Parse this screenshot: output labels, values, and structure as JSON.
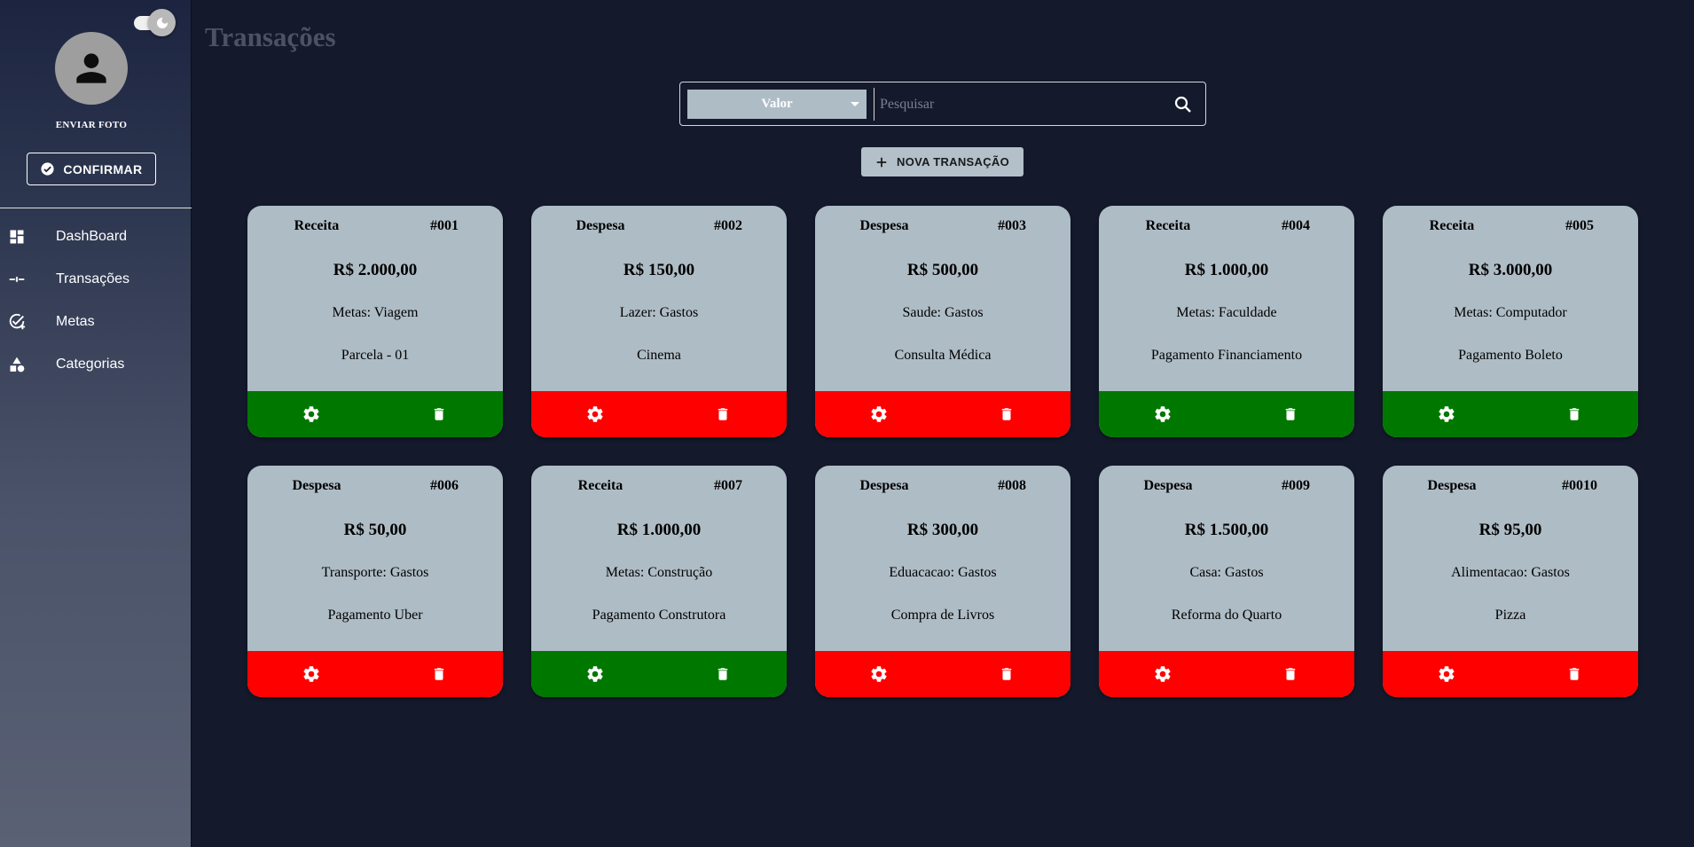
{
  "sidebar": {
    "upload_label": "ENVIAR FOTO",
    "confirm_label": "CONFIRMAR",
    "items": [
      {
        "label": "DashBoard",
        "icon": "dashboard-icon"
      },
      {
        "label": "Transações",
        "icon": "transactions-icon"
      },
      {
        "label": "Metas",
        "icon": "goals-icon"
      },
      {
        "label": "Categorias",
        "icon": "categories-icon"
      }
    ]
  },
  "header": {
    "title": "Transações"
  },
  "search": {
    "filter_selected": "Valor",
    "placeholder": "Pesquisar"
  },
  "new_transaction_label": "NOVA TRANSAÇÃO",
  "colors": {
    "receita": "#007800",
    "despesa": "#ff0000",
    "card_bg": "#aebcc5",
    "page_bg": "#141a2c"
  },
  "transactions": [
    {
      "type": "Receita",
      "id": "#001",
      "value": "R$ 2.000,00",
      "category": "Metas: Viagem",
      "description": "Parcela - 01"
    },
    {
      "type": "Despesa",
      "id": "#002",
      "value": "R$ 150,00",
      "category": "Lazer: Gastos",
      "description": "Cinema"
    },
    {
      "type": "Despesa",
      "id": "#003",
      "value": "R$ 500,00",
      "category": "Saude: Gastos",
      "description": "Consulta Médica"
    },
    {
      "type": "Receita",
      "id": "#004",
      "value": "R$ 1.000,00",
      "category": "Metas: Faculdade",
      "description": "Pagamento Financiamento"
    },
    {
      "type": "Receita",
      "id": "#005",
      "value": "R$ 3.000,00",
      "category": "Metas: Computador",
      "description": "Pagamento Boleto"
    },
    {
      "type": "Despesa",
      "id": "#006",
      "value": "R$ 50,00",
      "category": "Transporte: Gastos",
      "description": "Pagamento Uber"
    },
    {
      "type": "Receita",
      "id": "#007",
      "value": "R$ 1.000,00",
      "category": "Metas: Construção",
      "description": "Pagamento Construtora"
    },
    {
      "type": "Despesa",
      "id": "#008",
      "value": "R$ 300,00",
      "category": "Eduacacao: Gastos",
      "description": "Compra de Livros"
    },
    {
      "type": "Despesa",
      "id": "#009",
      "value": "R$ 1.500,00",
      "category": "Casa: Gastos",
      "description": "Reforma do Quarto"
    },
    {
      "type": "Despesa",
      "id": "#0010",
      "value": "R$ 95,00",
      "category": "Alimentacao: Gastos",
      "description": "Pizza"
    }
  ]
}
